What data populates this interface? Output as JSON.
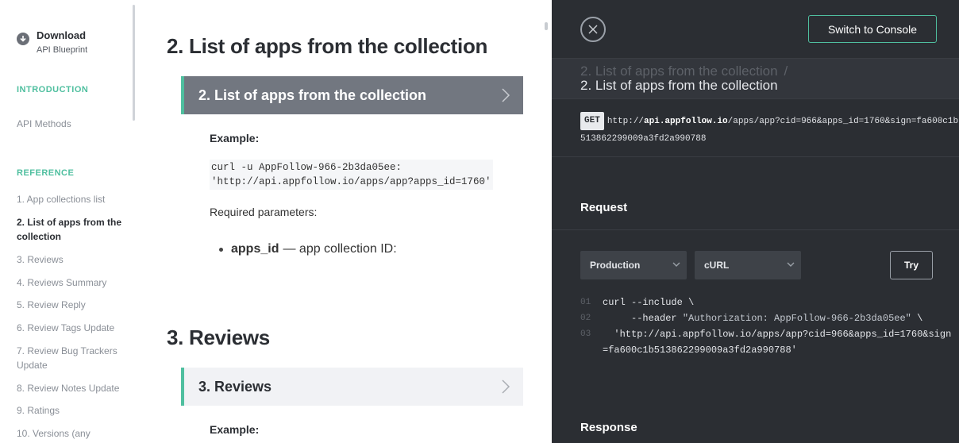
{
  "sidebar": {
    "download": {
      "title": "Download",
      "subtitle": "API Blueprint"
    },
    "intro_title": "INTRODUCTION",
    "intro_items": [
      "API Methods"
    ],
    "reference_title": "REFERENCE",
    "reference_items": [
      "1. App collections list",
      "2. List of apps from the collection",
      "3. Reviews",
      "4. Reviews Summary",
      "5. Review Reply",
      "6. Review Tags Update",
      "7. Review Bug Trackers Update",
      "8. Review Notes Update",
      "9. Ratings",
      "10. Versions (any"
    ],
    "active_index": 1
  },
  "main": {
    "section2": {
      "heading": "2. List of apps from the collection",
      "bar_label": "2. List of apps from the collection",
      "example_label": "Example:",
      "code_line1": "curl -u AppFollow-966-2b3da05ee:",
      "code_line2": "'http://api.appfollow.io/apps/app?apps_id=1760'",
      "required_label": "Required parameters:",
      "param_name": "apps_id",
      "param_desc": "— app collection ID:"
    },
    "section3": {
      "heading": "3. Reviews",
      "bar_label": "3. Reviews",
      "example_label": "Example:"
    }
  },
  "console": {
    "switch_label": "Switch to Console",
    "breadcrumb_prev": "2. List of apps from the collection",
    "breadcrumb_sep": "/",
    "breadcrumb_current": "2. List of apps from the collection",
    "method": "GET",
    "url_prefix": "http://",
    "url_host": "api.appfollow.io",
    "url_rest": "/apps/app?cid=966&apps_id=1760&sign=fa600c1b513862299009a3fd2a990788",
    "request_label": "Request",
    "env_select": "Production",
    "lang_select": "cURL",
    "try_label": "Try",
    "code": [
      {
        "ln": "01",
        "text": "curl --include \\"
      },
      {
        "ln": "02",
        "text": "     --header ",
        "str": "\"Authorization: AppFollow-966-2b3da05ee\"",
        "tail": " \\"
      },
      {
        "ln": "03",
        "text": "  'http://api.appfollow.io/apps/app?cid=966&apps_id=1760&sign=fa600c1b513862299009a3fd2a990788'"
      }
    ],
    "response_label": "Response"
  },
  "colors": {
    "accent": "#4fbf9f",
    "console_bg": "#2b2e33",
    "bar_dark": "#727780"
  },
  "icons": {
    "download": "download-circle-icon",
    "close": "close-circle-icon",
    "chevron": "chevron-right-icon",
    "select": "chevron-down-icon"
  }
}
